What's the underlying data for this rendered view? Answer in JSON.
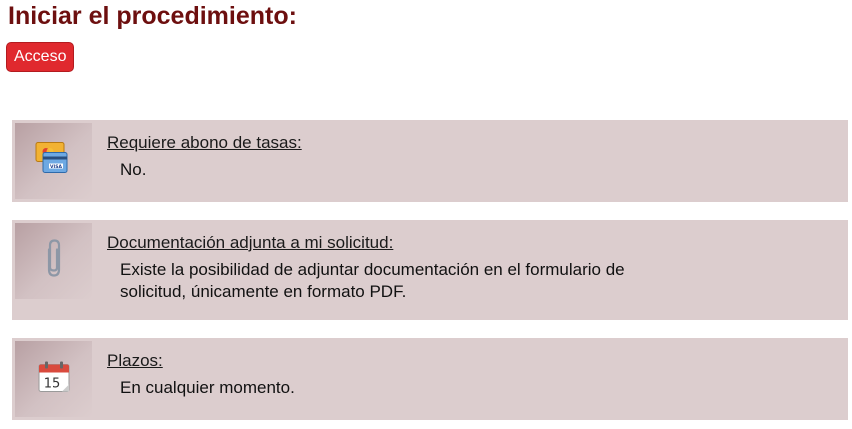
{
  "heading": "Iniciar el procedimiento:",
  "access_button": "Acceso",
  "colors": {
    "heading": "#6d0f0f",
    "button_bg": "#e0292e",
    "card_bg": "#dccdce"
  },
  "cards": [
    {
      "icon": "credit-cards-icon",
      "label": "Requiere abono de tasas:",
      "value": "No."
    },
    {
      "icon": "paperclip-icon",
      "label": "Documentación adjunta a mi solicitud:",
      "value": "Existe la posibilidad de adjuntar documentación en el formulario de solicitud, únicamente en formato PDF."
    },
    {
      "icon": "calendar-icon",
      "label": "Plazos:",
      "value": "En cualquier momento.",
      "calendar_day": "15"
    }
  ]
}
